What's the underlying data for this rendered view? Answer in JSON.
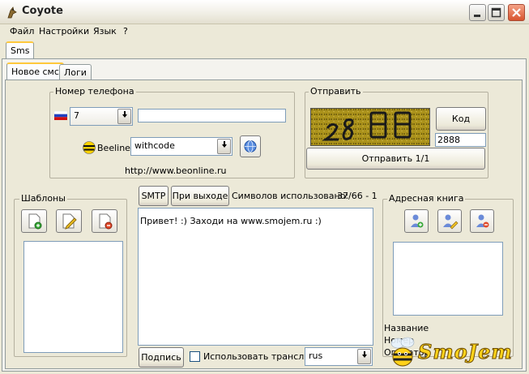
{
  "window": {
    "title": "Coyote"
  },
  "menu": {
    "items": [
      "Файл",
      "Настройки",
      "Язык",
      "?"
    ]
  },
  "top_tab": "Sms",
  "sub_tabs": [
    "Новое смс",
    "Логи"
  ],
  "phone": {
    "group_title": "Номер телефона",
    "country_code": "7",
    "number_value": "",
    "operator_name": "Beeline",
    "mode_value": "withcode",
    "site_url": "http://www.beonline.ru"
  },
  "send": {
    "group_title": "Отправить",
    "code_button": "Код",
    "captcha_value": "2888",
    "send_button": "Отправить 1/1"
  },
  "templates": {
    "group_title": "Шаблоны"
  },
  "message": {
    "smtp_button": "SMTP",
    "on_exit_button": "При выходе",
    "chars_label": "Символов использовано:",
    "chars_value": "37/66 - 1",
    "text": "Привет! :) Заходи на www.smojem.ru :)",
    "sign_button": "Подпись",
    "translit_label": "Использовать транслит",
    "lang_value": "rus"
  },
  "address_book": {
    "group_title": "Адресная книга",
    "name_label": "Название",
    "number_label": "Номер",
    "operator_label": "Оператор"
  },
  "watermark": {
    "text": "SmoJem"
  },
  "colors": {
    "accent_tab": "#ffc83c",
    "window_bg": "#ece9d8"
  }
}
